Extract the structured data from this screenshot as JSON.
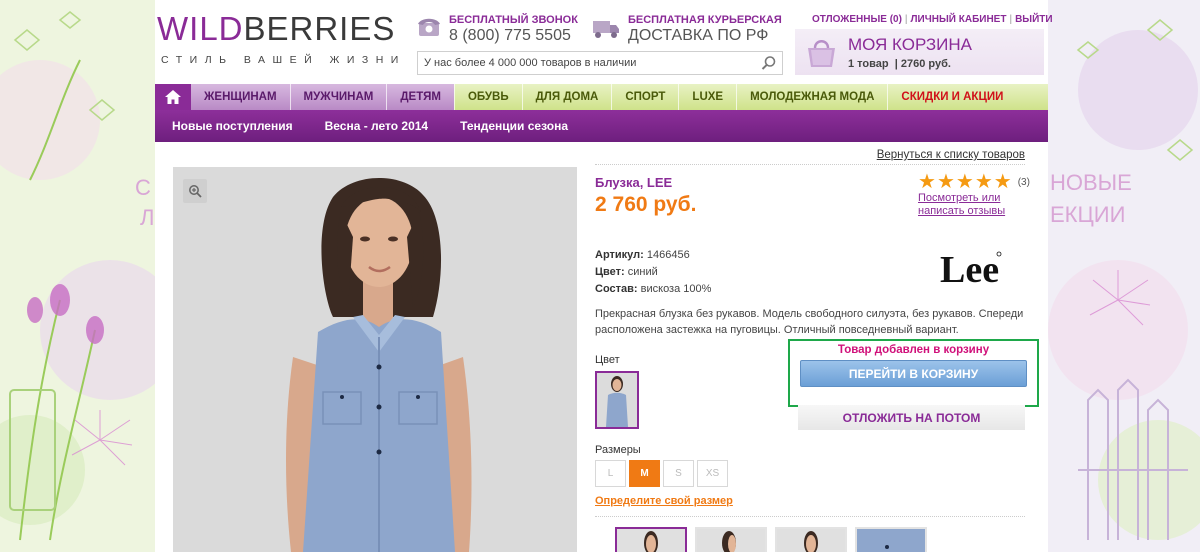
{
  "header": {
    "logo_purple": "WILD",
    "logo_dark": "BERRIES",
    "tagline": "СТИЛЬ ВАШЕЙ ЖИЗНИ",
    "call_title": "БЕСПЛАТНЫЙ ЗВОНОК",
    "call_number": "8 (800) 775 5505",
    "delivery_title": "БЕСПЛАТНАЯ КУРЬЕРСКАЯ",
    "delivery_text": "ДОСТАВКА ПО РФ",
    "search_placeholder": "У нас более 4 000 000 товаров в наличии",
    "links": [
      "ОТЛОЖЕННЫЕ (0)",
      "ЛИЧНЫЙ КАБИНЕТ",
      "ВЫЙТИ"
    ],
    "cart_title": "МОЯ КОРЗИНА",
    "cart_count": "1 товар",
    "cart_sum": "2760 руб."
  },
  "nav": {
    "items": [
      "ЖЕНЩИНАМ",
      "МУЖЧИНАМ",
      "ДЕТЯМ",
      "ОБУВЬ",
      "ДЛЯ ДОМА",
      "СПОРТ",
      "LUXE",
      "МОЛОДЕЖНАЯ МОДА",
      "СКИДКИ И АКЦИИ"
    ]
  },
  "subnav": {
    "items": [
      "Новые поступления",
      "Весна - лето 2014",
      "Тенденции сезона"
    ]
  },
  "product": {
    "back_link": "Вернуться к списку товаров",
    "title": "Блузка, LEE",
    "price": "2 760 руб.",
    "rating": 5,
    "reviews_count": "(3)",
    "reviews_link": "Посмотреть или написать отзывы",
    "article_label": "Артикул:",
    "article": "1466456",
    "color_label": "Цвет:",
    "color": "синий",
    "composition_label": "Состав:",
    "composition": "вискоза 100%",
    "brand": "Lee",
    "description": "Прекрасная блузка без рукавов. Модель свободного силуэта, без рукавов. Спереди расположена застежка на пуговицы. Отличный повседневный вариант.",
    "color_section": "Цвет",
    "added_msg": "Товар добавлен в корзину",
    "go_cart_button": "ПЕРЕЙТИ В КОРЗИНУ",
    "later_button": "ОТЛОЖИТЬ НА ПОТОМ",
    "sizes_label": "Размеры",
    "sizes": [
      "L",
      "M",
      "S",
      "XS"
    ],
    "selected_size": "M",
    "size_link": "Определите свой размер"
  },
  "colors": {
    "brand": "#8a2b97",
    "accent": "#f07a14",
    "added_border": "#1ea84a",
    "added_text": "#d0107a"
  }
}
